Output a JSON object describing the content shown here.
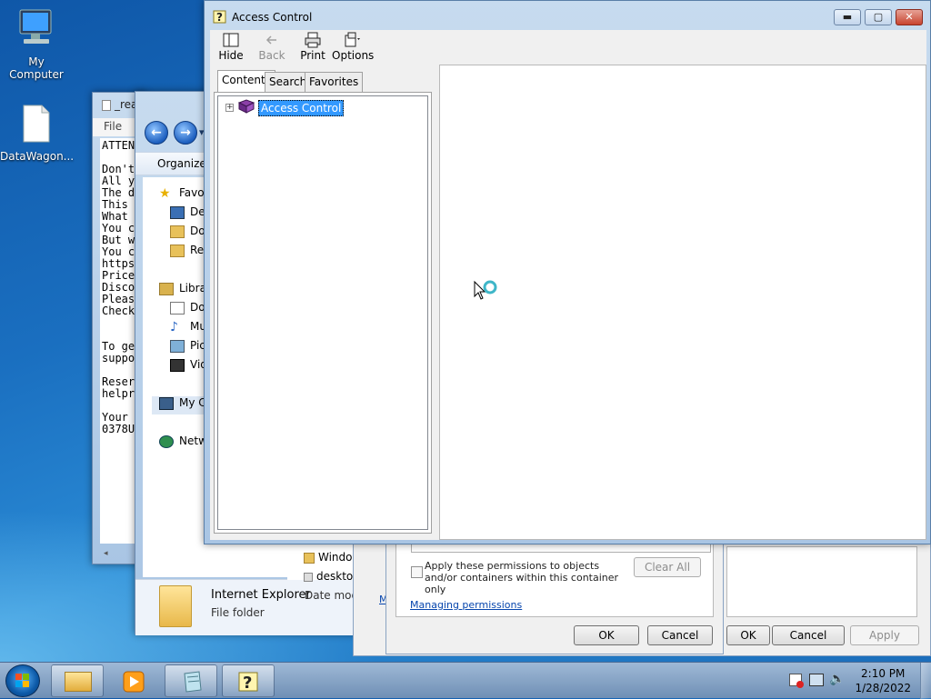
{
  "desktop": {
    "icons": [
      {
        "label": "My Computer"
      },
      {
        "label": "DataWagon..."
      }
    ]
  },
  "notepad": {
    "title": "_rea",
    "menu_file": "File",
    "text_lines": "ATTEN\n\nDon't\nAll y\nThe d\nThis\nWhat\nYou c\nBut w\nYou c\nhttps\nPrice\nDisco\nPleas\nCheck\n\n\nTo ge\nsuppo\n\nReser\nhelpr\n\nYour\n0378U"
  },
  "explorer": {
    "organize": "Organize",
    "nav_dropdown": "▾",
    "tree": {
      "favorites": "Favor",
      "desktop": "Des",
      "downloads": "Dov",
      "recent": "Rec",
      "libraries": "Libra",
      "documents": "Doc",
      "music": "Mu",
      "pictures": "Pict",
      "videos": "Vid",
      "my_computer": "My C",
      "network": "Netw"
    },
    "list_items": [
      "Windo",
      "deskto"
    ],
    "details_name": "Internet Explorer",
    "details_type": "File folder",
    "details_date": "Date mod"
  },
  "props_dialog": {
    "checkbox_label": "Apply these permissions to objects and/or containers within this container only",
    "clear_all": "Clear All",
    "managing_link": "Managing permissions",
    "ok": "OK",
    "cancel": "Cancel",
    "outer_ok": "OK",
    "outer_cancel": "Cancel",
    "outer_apply": "Apply",
    "outer_link_fragment": "M"
  },
  "help_window": {
    "title": "Access Control",
    "toolbar": {
      "hide": "Hide",
      "back": "Back",
      "print": "Print",
      "options": "Options"
    },
    "tabs": {
      "contents": "Contents",
      "search": "Search",
      "favorites": "Favorites"
    },
    "tree_node": "Access Control",
    "caption": {
      "minimize": "▬",
      "maximize": "▢",
      "close": "✕"
    }
  },
  "taskbar": {
    "time": "2:10 PM",
    "date": "1/28/2022"
  },
  "colors": {
    "selection": "#3399ff",
    "link": "#0645ad"
  }
}
